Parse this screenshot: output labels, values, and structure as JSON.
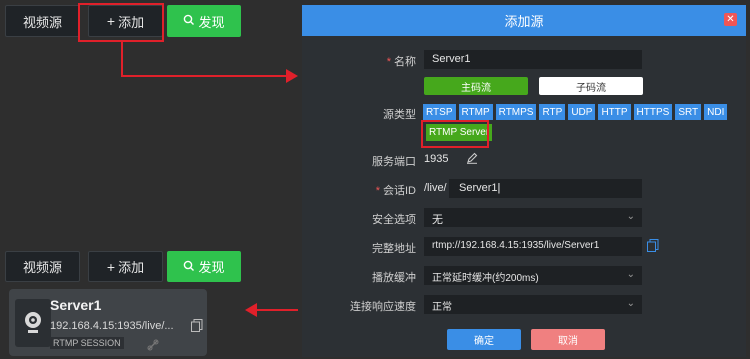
{
  "top_toolbar": {
    "video_source_label": "视频源",
    "add_label": "添加",
    "discover_label": "发现"
  },
  "bottom_toolbar": {
    "video_source_label": "视频源",
    "add_label": "添加",
    "discover_label": "发现"
  },
  "source_card": {
    "name": "Server1",
    "url": "192.168.4.15:1935/live/...",
    "tag": "RTMP SESSION"
  },
  "dialog": {
    "title": "添加源",
    "name_label": "名称",
    "name_value": "Server1",
    "main_stream_label": "主码流",
    "sub_stream_label": "子码流",
    "source_type_label": "源类型",
    "source_types": [
      "RTSP",
      "RTMP",
      "RTMPS",
      "RTP",
      "UDP",
      "HTTP",
      "HTTPS",
      "SRT",
      "NDI"
    ],
    "selected_type": "RTMP Server",
    "port_label": "服务端口",
    "port_value": "1935",
    "session_label": "会话ID",
    "session_prefix": "/live/",
    "session_value": "Server1",
    "security_label": "安全选项",
    "security_value": "无",
    "full_address_label": "完整地址",
    "full_address_value": "rtmp://192.168.4.15:1935/live/Server1",
    "buffer_label": "播放缓冲",
    "buffer_value": "正常延时缓冲(约200ms)",
    "response_label": "连接响应速度",
    "response_value": "正常",
    "confirm_label": "确定",
    "cancel_label": "取消"
  },
  "colors": {
    "accent_blue": "#3a8ee6",
    "green": "#2fc24d",
    "highlight_red": "#e0202a"
  }
}
